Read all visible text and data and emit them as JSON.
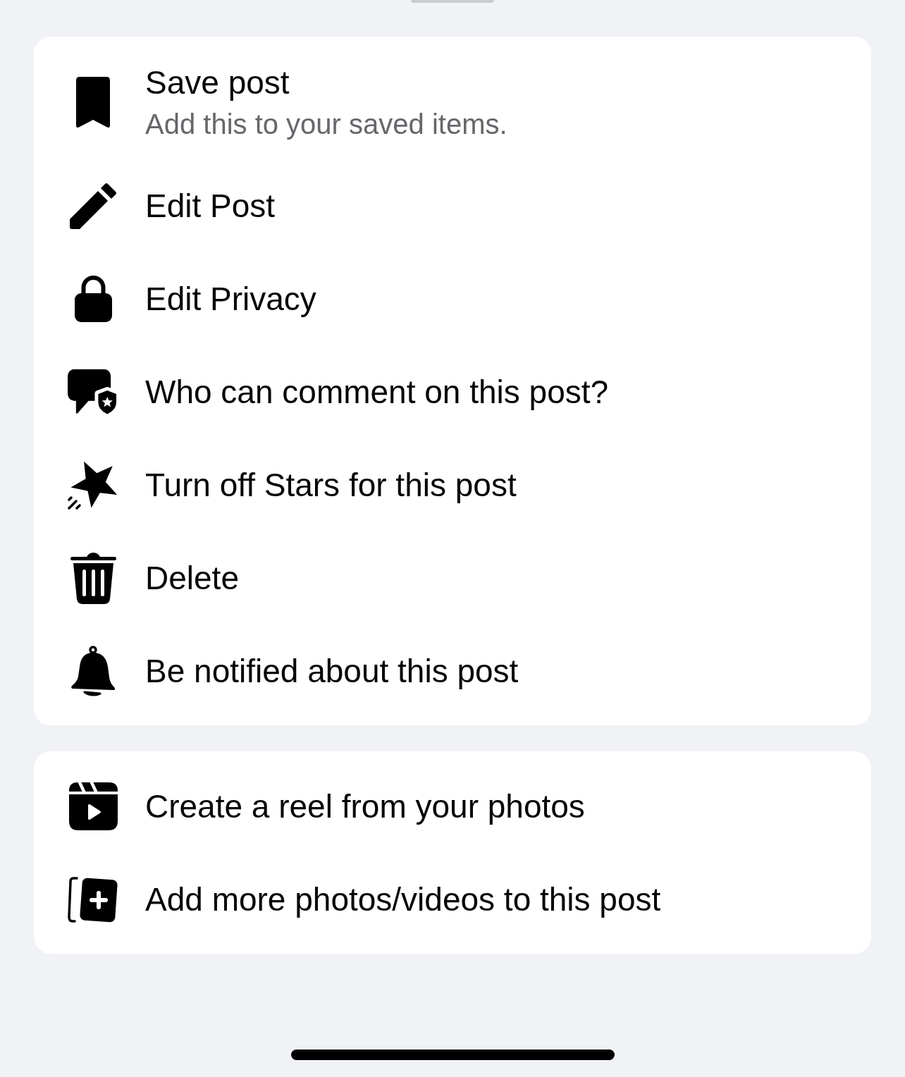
{
  "sections": [
    {
      "items": [
        {
          "label": "Save post",
          "description": "Add this to your saved items."
        },
        {
          "label": "Edit Post"
        },
        {
          "label": "Edit Privacy"
        },
        {
          "label": "Who can comment on this post?"
        },
        {
          "label": "Turn off Stars for this post"
        },
        {
          "label": "Delete"
        },
        {
          "label": "Be notified about this post"
        }
      ]
    },
    {
      "items": [
        {
          "label": "Create a reel from your photos"
        },
        {
          "label": "Add more photos/videos to this post"
        }
      ]
    }
  ]
}
